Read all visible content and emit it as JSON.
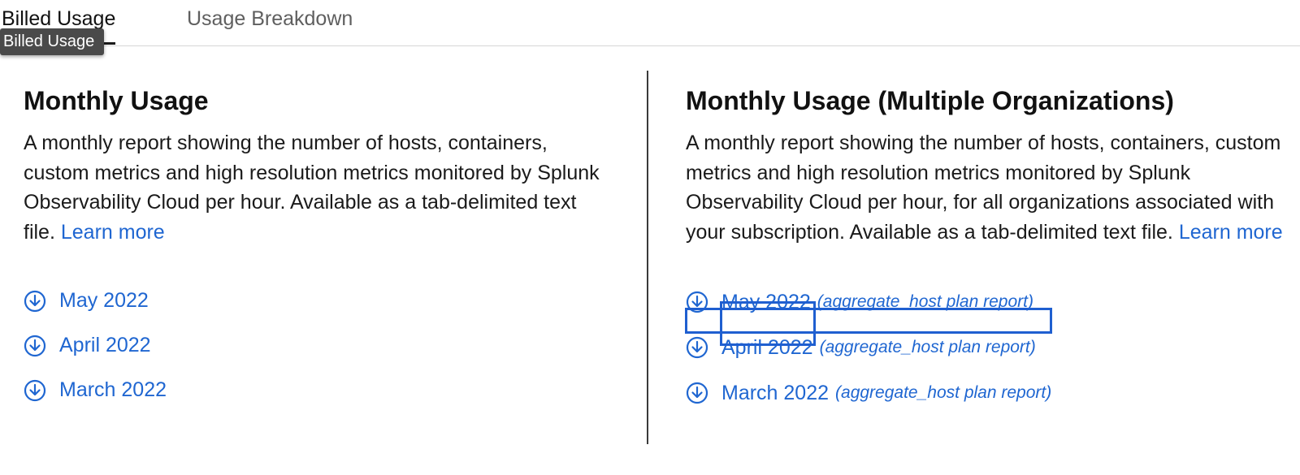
{
  "tabs": {
    "billed_usage": "Billed Usage",
    "usage_breakdown": "Usage Breakdown",
    "tooltip": "Billed Usage"
  },
  "left": {
    "title": "Monthly Usage",
    "description": "A monthly report showing the number of hosts, containers, custom metrics and high resolution metrics monitored by Splunk Observability Cloud per hour. Available as a tab-delimited text file.",
    "learn_more": "Learn more",
    "downloads": [
      {
        "label": "May 2022",
        "icon": "download-icon"
      },
      {
        "label": "April 2022",
        "icon": "download-icon"
      },
      {
        "label": "March 2022",
        "icon": "download-icon"
      }
    ]
  },
  "right": {
    "title": "Monthly Usage (Multiple Organizations)",
    "description": "A monthly report showing the number of hosts, containers, custom metrics and high resolution metrics monitored by Splunk Observability Cloud per hour, for all organizations associated with your subscription. Available as a tab-delimited text file.",
    "learn_more": "Learn more",
    "downloads": [
      {
        "label": "May 2022",
        "note": "(aggregate_host plan report)",
        "icon": "download-icon",
        "selected": true
      },
      {
        "label": "April 2022",
        "note": "(aggregate_host plan report)",
        "icon": "download-icon"
      },
      {
        "label": "March 2022",
        "note": "(aggregate_host plan report)",
        "icon": "download-icon"
      }
    ]
  },
  "colors": {
    "link": "#1f66d1",
    "selection": "#1f5fd0",
    "tooltip_bg": "#4a4a4a"
  }
}
